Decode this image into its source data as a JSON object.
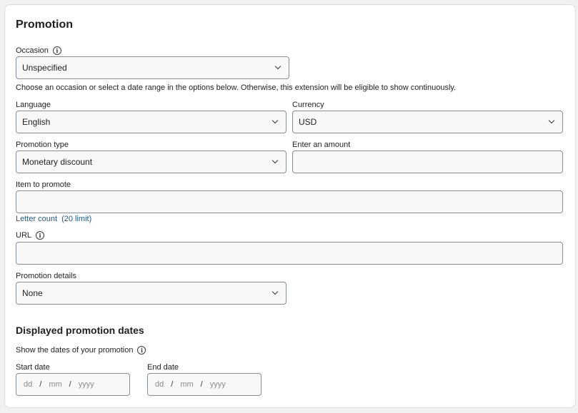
{
  "promotion": {
    "title": "Promotion",
    "occasion": {
      "label": "Occasion",
      "value": "Unspecified",
      "help": "Choose an occasion or select a date range in the options below. Otherwise, this extension will be eligible to show continuously."
    },
    "language": {
      "label": "Language",
      "value": "English"
    },
    "currency": {
      "label": "Currency",
      "value": "USD"
    },
    "promotion_type": {
      "label": "Promotion type",
      "value": "Monetary discount"
    },
    "amount": {
      "label": "Enter an amount",
      "value": ""
    },
    "item": {
      "label": "Item to promote",
      "value": "",
      "letter_count": "Letter count",
      "limit": "(20 limit)"
    },
    "url": {
      "label": "URL",
      "value": ""
    },
    "details": {
      "label": "Promotion details",
      "value": "None"
    }
  },
  "dates": {
    "title": "Displayed promotion dates",
    "show_label": "Show the dates of your promotion",
    "start": {
      "label": "Start date",
      "dd": "dd",
      "mm": "mm",
      "yyyy": "yyyy",
      "sep": "/"
    },
    "end": {
      "label": "End date",
      "dd": "dd",
      "mm": "mm",
      "yyyy": "yyyy",
      "sep": "/"
    }
  },
  "icons": {
    "info": "info-icon",
    "dropdown": "chevron-down-icon"
  },
  "colors": {
    "link": "#1a5c8c",
    "field_bg": "#f8f8f8",
    "field_border": "#8a8f95"
  }
}
